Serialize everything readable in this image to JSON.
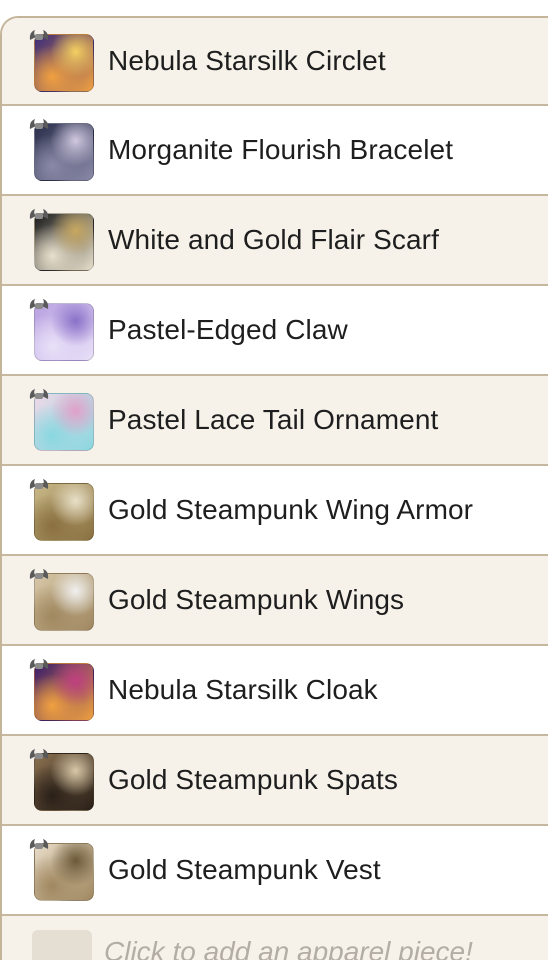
{
  "apparel_list": {
    "items": [
      {
        "name": "Nebula Starsilk Circlet",
        "icon": "nebula-circlet-icon",
        "colors": [
          "#3a2a7a",
          "#f0a040",
          "#f5d060"
        ]
      },
      {
        "name": "Morganite Flourish Bracelet",
        "icon": "bracelet-icon",
        "colors": [
          "#2a2e4a",
          "#8a8aa8",
          "#d0c8e0"
        ]
      },
      {
        "name": "White and Gold Flair Scarf",
        "icon": "scarf-icon",
        "colors": [
          "#1a1a1a",
          "#e8e0cc",
          "#c8a860"
        ]
      },
      {
        "name": "Pastel-Edged Claw",
        "icon": "claw-icon",
        "colors": [
          "#b8a0e0",
          "#e8e0f8",
          "#8a70c8"
        ]
      },
      {
        "name": "Pastel Lace Tail Ornament",
        "icon": "tail-ornament-icon",
        "colors": [
          "#f0d8e8",
          "#8ad8e0",
          "#e0a0c8"
        ]
      },
      {
        "name": "Gold Steampunk Wing Armor",
        "icon": "wing-armor-icon",
        "colors": [
          "#c8b888",
          "#8a7040",
          "#e8e0c8"
        ]
      },
      {
        "name": "Gold Steampunk Wings",
        "icon": "wings-icon",
        "colors": [
          "#d8c8a8",
          "#a08860",
          "#f0f0f0"
        ]
      },
      {
        "name": "Nebula Starsilk Cloak",
        "icon": "cloak-icon",
        "colors": [
          "#3a1a6a",
          "#f0a040",
          "#c04080"
        ]
      },
      {
        "name": "Gold Steampunk Spats",
        "icon": "spats-icon",
        "colors": [
          "#8a7050",
          "#2a2018",
          "#d8c8a8"
        ]
      },
      {
        "name": "Gold Steampunk Vest",
        "icon": "vest-icon",
        "colors": [
          "#e8dcc8",
          "#a08860",
          "#6a5838"
        ]
      }
    ],
    "add_placeholder": "Click to add an apparel piece!"
  },
  "colors": {
    "border": "#c6b79f",
    "row_alt": "#f6f2ea",
    "row_white": "#ffffff",
    "placeholder_text": "#b3ada3"
  }
}
